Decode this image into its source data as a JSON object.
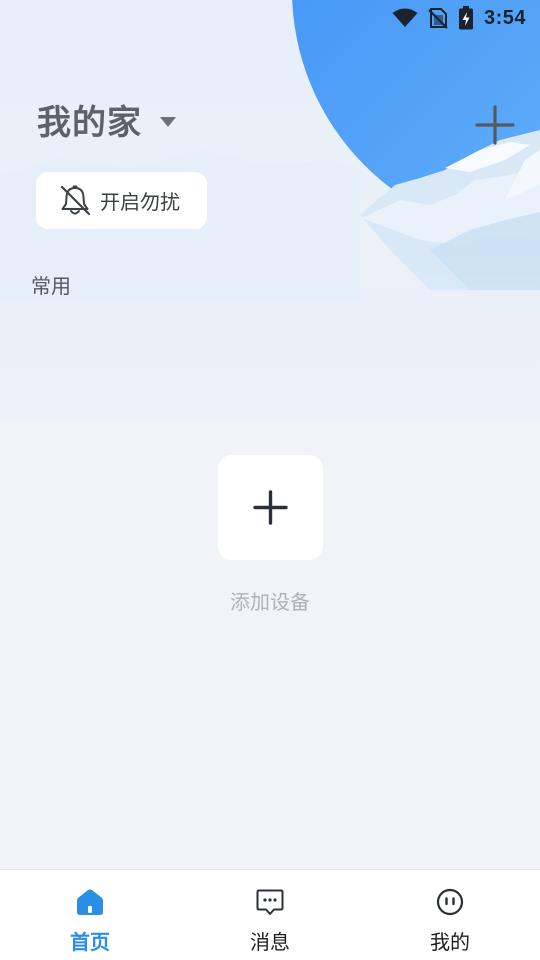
{
  "status_bar": {
    "time": "3:54",
    "icons": [
      "wifi-icon",
      "no-sim-icon",
      "battery-charging-icon"
    ]
  },
  "header": {
    "home_name": "我的家",
    "dropdown_icon": "caret-down-icon",
    "add_icon": "plus-icon"
  },
  "dnd_chip": {
    "label": "开启勿扰",
    "icon": "bell-off-icon"
  },
  "section": {
    "label": "常用"
  },
  "add_device": {
    "icon": "plus-icon",
    "label": "添加设备"
  },
  "bottom_nav": {
    "items": [
      {
        "label": "首页",
        "icon": "home-icon",
        "active": true
      },
      {
        "label": "消息",
        "icon": "message-icon",
        "active": false
      },
      {
        "label": "我的",
        "icon": "profile-icon",
        "active": false
      }
    ]
  },
  "colors": {
    "accent": "#2a8ee8",
    "background": "#f1f3f8",
    "sky_blue": "#4b9cf5",
    "title_gray": "#5d6169"
  }
}
